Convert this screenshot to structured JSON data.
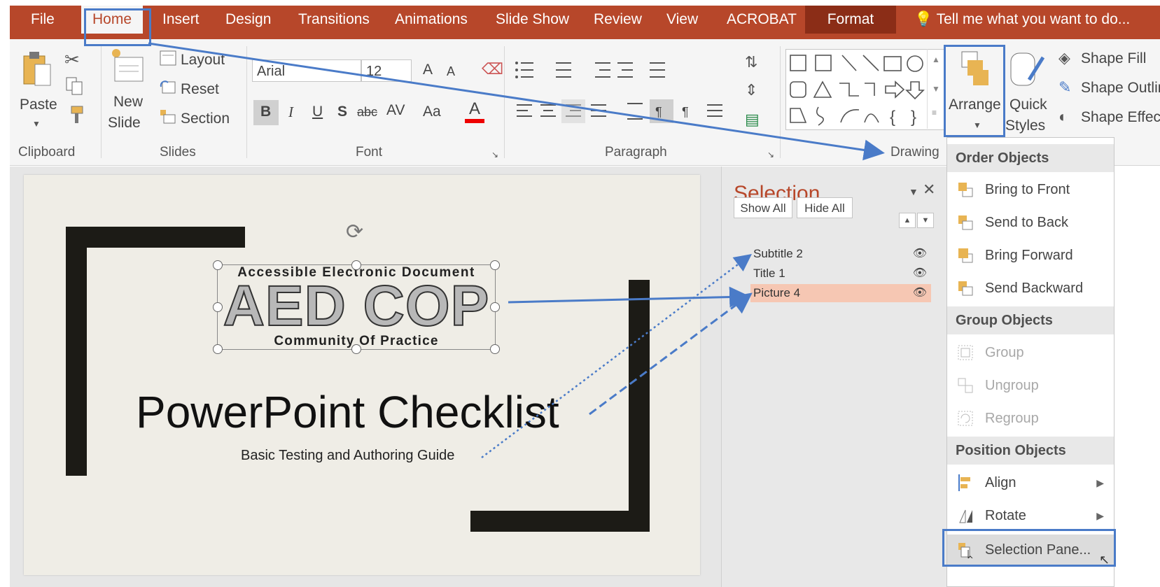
{
  "tabs": {
    "file": "File",
    "home": "Home",
    "insert": "Insert",
    "design": "Design",
    "transitions": "Transitions",
    "animations": "Animations",
    "slideshow": "Slide Show",
    "review": "Review",
    "view": "View",
    "acrobat": "ACROBAT",
    "format": "Format",
    "tellme": "Tell me what you want to do..."
  },
  "clipboard": {
    "paste": "Paste",
    "label": "Clipboard"
  },
  "slides": {
    "new1": "New",
    "new2": "Slide",
    "layout": "Layout",
    "reset": "Reset",
    "section": "Section",
    "label": "Slides"
  },
  "font": {
    "name": "Arial",
    "size": "12",
    "bold": "B",
    "italic": "I",
    "underline": "U",
    "shadow": "S",
    "strike": "abc",
    "spacing": "AV",
    "case": "Aa",
    "color": "A",
    "grow": "A",
    "shrink": "A",
    "label": "Font"
  },
  "paragraph": {
    "label": "Paragraph"
  },
  "drawing": {
    "arrange": "Arrange",
    "quick1": "Quick",
    "quick2": "Styles",
    "fill": "Shape Fill",
    "outline": "Shape Outline",
    "effects": "Shape Effects",
    "label": "Drawing"
  },
  "slide": {
    "logo_top": "Accessible Electronic Document",
    "logo_main": "AED COP",
    "logo_bottom": "Community Of Practice",
    "title": "PowerPoint Checklist",
    "subtitle": "Basic Testing and Authoring Guide"
  },
  "selection": {
    "title": "Selection",
    "show_all": "Show All",
    "hide_all": "Hide All",
    "items": [
      "Subtitle 2",
      "Title 1",
      "Picture 4"
    ]
  },
  "menu": {
    "order_header": "Order Objects",
    "bring_front": "Bring to Front",
    "send_back": "Send to Back",
    "bring_forward": "Bring Forward",
    "send_backward": "Send Backward",
    "group_header": "Group Objects",
    "group": "Group",
    "ungroup": "Ungroup",
    "regroup": "Regroup",
    "position_header": "Position Objects",
    "align": "Align",
    "rotate": "Rotate",
    "selection_pane": "Selection Pane..."
  },
  "colors": {
    "accent": "#b7472a",
    "annotation": "#4a7bc8",
    "selected": "#f6c7b3"
  }
}
